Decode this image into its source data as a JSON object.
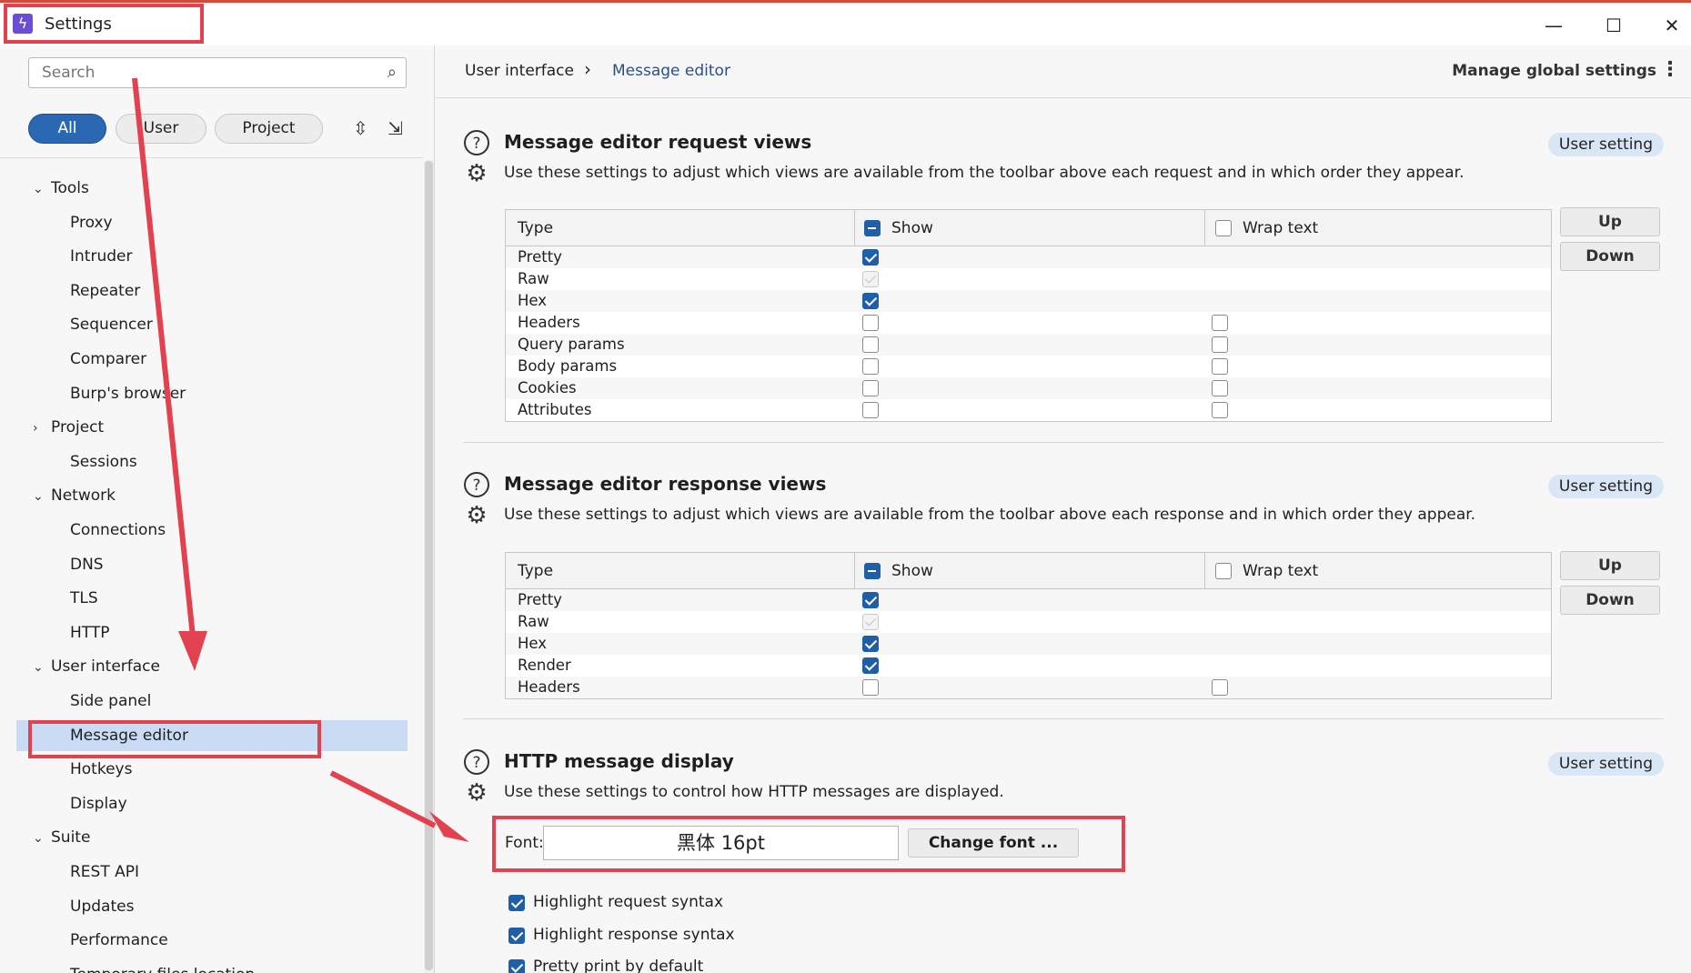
{
  "window": {
    "title": "Settings",
    "minimize": "—",
    "maximize": "☐",
    "close": "✕"
  },
  "sidebar": {
    "search_placeholder": "Search",
    "filters": [
      "All",
      "User",
      "Project"
    ],
    "tree": [
      {
        "label": "Tools",
        "chev": "⌄"
      },
      {
        "label": "Proxy"
      },
      {
        "label": "Intruder"
      },
      {
        "label": "Repeater"
      },
      {
        "label": "Sequencer"
      },
      {
        "label": "Comparer"
      },
      {
        "label": "Burp's browser"
      },
      {
        "label": "Project",
        "chev": "›"
      },
      {
        "label": "Sessions"
      },
      {
        "label": "Network",
        "chev": "⌄"
      },
      {
        "label": "Connections"
      },
      {
        "label": "DNS"
      },
      {
        "label": "TLS"
      },
      {
        "label": "HTTP"
      },
      {
        "label": "User interface",
        "chev": "⌄"
      },
      {
        "label": "Side panel"
      },
      {
        "label": "Message editor",
        "selected": true
      },
      {
        "label": "Hotkeys"
      },
      {
        "label": "Display"
      },
      {
        "label": "Suite",
        "chev": "⌄"
      },
      {
        "label": "REST API"
      },
      {
        "label": "Updates"
      },
      {
        "label": "Performance"
      },
      {
        "label": "Temporary files location"
      }
    ]
  },
  "header": {
    "breadcrumb_parent": "User interface",
    "breadcrumb_sep": "›",
    "breadcrumb_current": "Message editor",
    "manage_label": "Manage global settings",
    "kebab": "⋮"
  },
  "sections": {
    "request": {
      "title": "Message editor request views",
      "desc": "Use these settings to adjust which views are available from the toolbar above each request and in which order they appear.",
      "badge": "User setting",
      "columns": [
        "Type",
        "Show",
        "Wrap text"
      ],
      "rows": [
        {
          "type": "Pretty",
          "show": "checked",
          "wrap": "none"
        },
        {
          "type": "Raw",
          "show": "disabled",
          "wrap": "none"
        },
        {
          "type": "Hex",
          "show": "checked",
          "wrap": "none"
        },
        {
          "type": "Headers",
          "show": "unchecked",
          "wrap": "unchecked"
        },
        {
          "type": "Query params",
          "show": "unchecked",
          "wrap": "unchecked"
        },
        {
          "type": "Body params",
          "show": "unchecked",
          "wrap": "unchecked"
        },
        {
          "type": "Cookies",
          "show": "unchecked",
          "wrap": "unchecked"
        },
        {
          "type": "Attributes",
          "show": "unchecked",
          "wrap": "unchecked"
        }
      ],
      "up": "Up",
      "down": "Down"
    },
    "response": {
      "title": "Message editor response views",
      "desc": "Use these settings to adjust which views are available from the toolbar above each response and in which order they appear.",
      "badge": "User setting",
      "columns": [
        "Type",
        "Show",
        "Wrap text"
      ],
      "rows": [
        {
          "type": "Pretty",
          "show": "checked",
          "wrap": "none"
        },
        {
          "type": "Raw",
          "show": "disabled",
          "wrap": "none"
        },
        {
          "type": "Hex",
          "show": "checked",
          "wrap": "none"
        },
        {
          "type": "Render",
          "show": "checked",
          "wrap": "none"
        },
        {
          "type": "Headers",
          "show": "unchecked",
          "wrap": "unchecked"
        }
      ],
      "up": "Up",
      "down": "Down"
    },
    "http": {
      "title": "HTTP message display",
      "desc": "Use these settings to control how HTTP messages are displayed.",
      "badge": "User setting",
      "font_label": "Font:",
      "font_value": "黑体  16pt",
      "change_font": "Change font ...",
      "options": [
        {
          "label": "Highlight request syntax",
          "checked": true
        },
        {
          "label": "Highlight response syntax",
          "checked": true
        },
        {
          "label": "Pretty print by default",
          "checked": true
        }
      ]
    }
  },
  "icons": {
    "search": "⌕",
    "help": "?",
    "gear": "⚙",
    "expand": "⇳",
    "collapse": "⇲"
  },
  "colors": {
    "accent": "#2b68b4",
    "annotation": "#e2414f",
    "selected": "#cadcf3",
    "badge": "#d9e6f5"
  }
}
